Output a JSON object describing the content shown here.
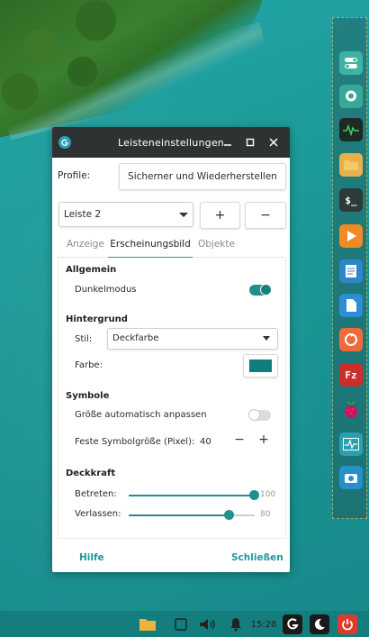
{
  "dialog": {
    "title": "Leisteneinstellungen",
    "profile_label": "Profile:",
    "profile_button": "Sicherner und Wiederherstellen",
    "panel_select": "Leiste 2",
    "add_label": "+",
    "remove_label": "−",
    "tabs": [
      "Anzeige",
      "Erscheinungsbild",
      "Objekte"
    ],
    "active_tab": "Erscheinungsbild",
    "sections": {
      "general": {
        "heading": "Allgemein",
        "dark_mode_label": "Dunkelmodus",
        "dark_mode_on": true
      },
      "background": {
        "heading": "Hintergrund",
        "style_label": "Stil:",
        "style_value": "Deckfarbe",
        "color_label": "Farbe:",
        "color_value": "#0e7d7d"
      },
      "icons": {
        "heading": "Symbole",
        "auto_size_label": "Größe automatisch anpassen",
        "auto_size_on": false,
        "fixed_size_label": "Feste Symbolgröße (Pixel):",
        "fixed_size_value": "40",
        "minus": "−",
        "plus": "+"
      },
      "opacity": {
        "heading": "Deckkraft",
        "enter_label": "Betreten:",
        "enter_value": "100",
        "enter_percent": 100,
        "leave_label": "Verlassen:",
        "leave_value": "80",
        "leave_percent": 80
      }
    },
    "help_label": "Hilfe",
    "close_label": "Schließen"
  },
  "tray": {
    "clock": "15:28"
  },
  "colors": {
    "accent": "#1f9a9a",
    "titlebar": "#2f3233",
    "desktop": "#1f9a9a",
    "panel": "#147e7e"
  }
}
